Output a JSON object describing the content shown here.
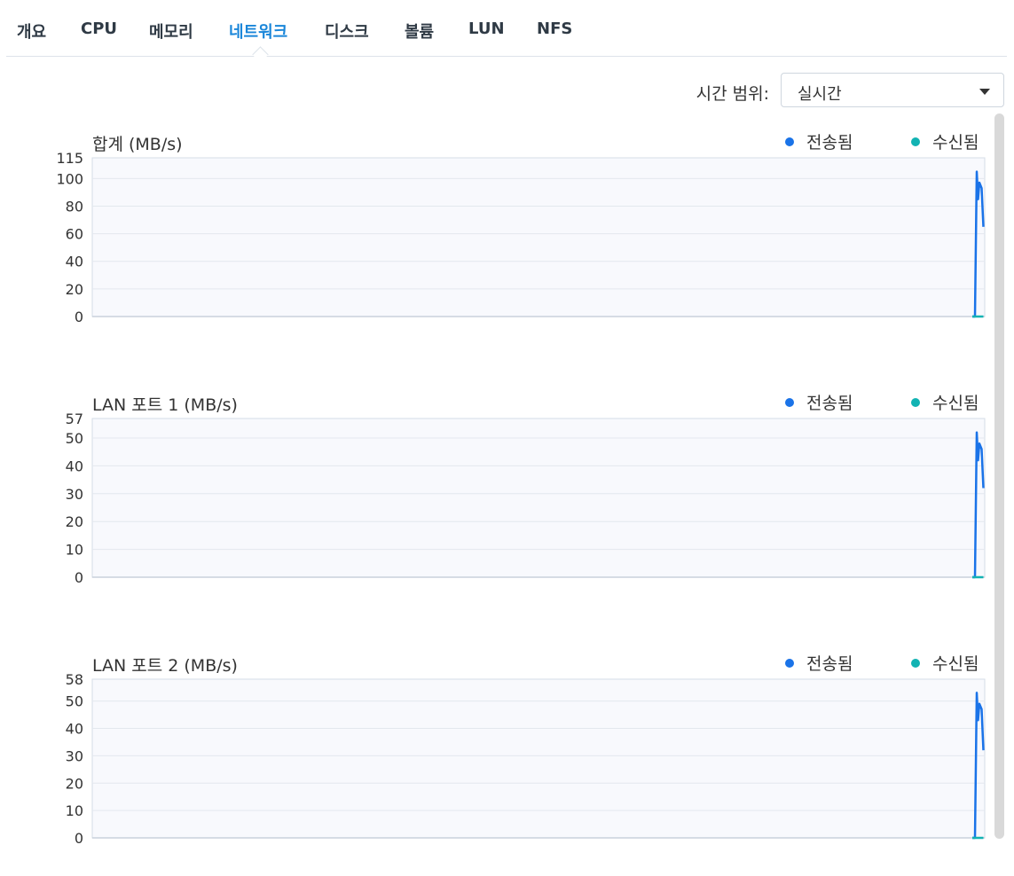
{
  "tabs": [
    {
      "label": "개요",
      "active": false
    },
    {
      "label": "CPU",
      "active": false
    },
    {
      "label": "메모리",
      "active": false
    },
    {
      "label": "네트워크",
      "active": true
    },
    {
      "label": "디스크",
      "active": false
    },
    {
      "label": "볼륨",
      "active": false
    },
    {
      "label": "LUN",
      "active": false
    },
    {
      "label": "NFS",
      "active": false
    }
  ],
  "time_range": {
    "label": "시간 범위:",
    "value": "실시간"
  },
  "legend": {
    "sent": "전송됨",
    "received": "수신됨"
  },
  "colors": {
    "sent": "#1a73e8",
    "received": "#12b3b3",
    "grid": "#e3e8ee",
    "plot_bg": "#f8f9fd",
    "active_tab": "#1a86d9"
  },
  "chart_data": [
    {
      "type": "line",
      "title": "합계 (MB/s)",
      "ylim": [
        0,
        115
      ],
      "yticks": [
        "0",
        "20",
        "40",
        "60",
        "80",
        "100",
        "115"
      ],
      "series": [
        {
          "name": "전송됨",
          "values": [
            0,
            0,
            105,
            85,
            97,
            93,
            65
          ]
        },
        {
          "name": "수신됨",
          "values": [
            0,
            0,
            0,
            0,
            0,
            0,
            0
          ]
        }
      ]
    },
    {
      "type": "line",
      "title": "LAN 포트 1 (MB/s)",
      "ylim": [
        0,
        57
      ],
      "yticks": [
        "0",
        "10",
        "20",
        "30",
        "40",
        "50",
        "57"
      ],
      "series": [
        {
          "name": "전송됨",
          "values": [
            0,
            0,
            52,
            42,
            48,
            46,
            32
          ]
        },
        {
          "name": "수신됨",
          "values": [
            0,
            0,
            0,
            0,
            0,
            0,
            0
          ]
        }
      ]
    },
    {
      "type": "line",
      "title": "LAN 포트 2 (MB/s)",
      "ylim": [
        0,
        58
      ],
      "yticks": [
        "0",
        "10",
        "20",
        "30",
        "40",
        "50",
        "58"
      ],
      "series": [
        {
          "name": "전송됨",
          "values": [
            0,
            0,
            53,
            43,
            49,
            47,
            32
          ]
        },
        {
          "name": "수신됨",
          "values": [
            0,
            0,
            0,
            0,
            0,
            0,
            0
          ]
        }
      ]
    }
  ]
}
